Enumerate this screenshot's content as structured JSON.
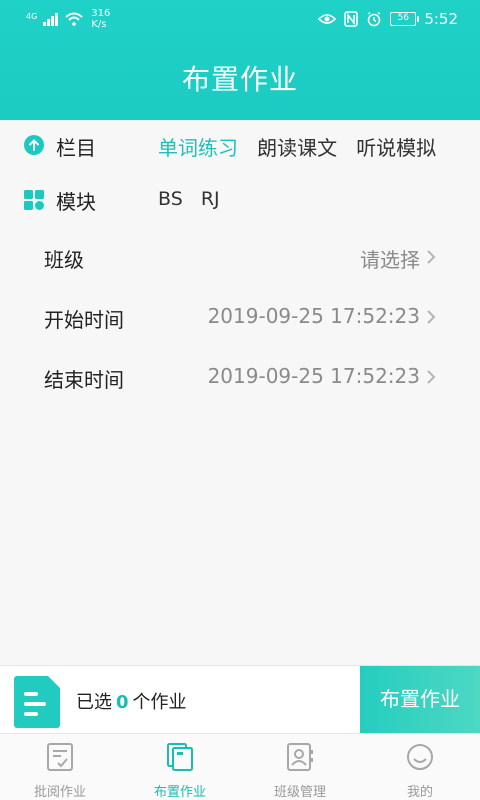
{
  "status_bar": {
    "network_type": "4G",
    "speed_value": "316",
    "speed_unit": "K/s",
    "battery": "56",
    "time": "5:52"
  },
  "header": {
    "title": "布置作业"
  },
  "category": {
    "label": "栏目",
    "tabs": [
      "单词练习",
      "朗读课文",
      "听说模拟"
    ],
    "active_tab_index": 0
  },
  "module": {
    "label": "模块",
    "options": [
      "BS",
      "RJ"
    ]
  },
  "form": {
    "class": {
      "label": "班级",
      "value": "请选择"
    },
    "start_time": {
      "label": "开始时间",
      "value": "2019-09-25 17:52:23"
    },
    "end_time": {
      "label": "结束时间",
      "value": "2019-09-25 17:52:23"
    }
  },
  "action_bar": {
    "selected_prefix": "已选",
    "selected_count": "0",
    "selected_suffix": "个作业",
    "assign_label": "布置作业"
  },
  "bottom_nav": {
    "items": [
      {
        "label": "批阅作业",
        "icon": "review-icon"
      },
      {
        "label": "布置作业",
        "icon": "assign-icon"
      },
      {
        "label": "班级管理",
        "icon": "class-manage-icon"
      },
      {
        "label": "我的",
        "icon": "smile-icon"
      }
    ],
    "active_index": 1
  },
  "colors": {
    "accent": "#1cc9c0",
    "header_bg": "#1fd1c6",
    "inactive_nav": "#9a9a9a"
  }
}
